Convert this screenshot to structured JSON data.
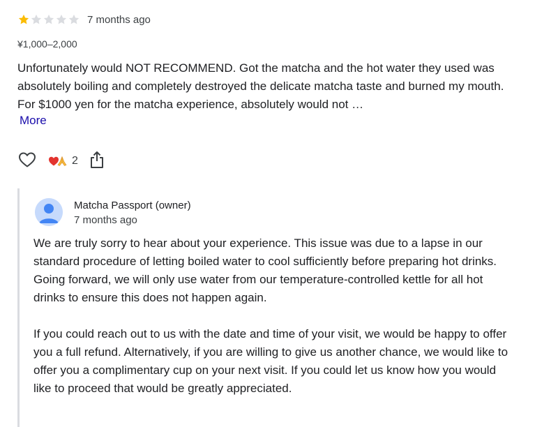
{
  "review": {
    "rating": 1,
    "rating_max": 5,
    "time_ago": "7 months ago",
    "price_range": "¥1,000–2,000",
    "text": "Unfortunately would NOT RECOMMEND. Got the matcha and the hot water they used was absolutely boiling and completely destroyed the delicate matcha taste and burned my mouth. For $1000 yen for the matcha experience, absolutely would not …",
    "more_label": "More",
    "reactions": {
      "icons": [
        "heart-emoji",
        "folded-hands-emoji"
      ],
      "count": "2"
    },
    "actions": {
      "like_icon": "heart-outline-icon",
      "share_icon": "share-icon"
    },
    "colors": {
      "star_filled": "#fbbc04",
      "star_empty": "#dadce0",
      "link": "#1a0dab"
    }
  },
  "owner_reply": {
    "name": "Matcha Passport (owner)",
    "time_ago": "7 months ago",
    "avatar_icon": "default-avatar-icon",
    "paragraphs": [
      "We are truly sorry to hear about your experience. This issue was due to a lapse in our standard procedure of letting boiled water to cool sufficiently before preparing hot drinks. Going forward, we will only use water from our temperature-controlled kettle for all hot drinks to ensure this does not happen again.",
      "If you could reach out to us with the date and time of your visit, we would be happy to offer you a full refund. Alternatively, if you are willing to give us another chance, we would like to offer you a complimentary cup on your next visit. If you could let us know how you would like to proceed that would be greatly appreciated."
    ]
  }
}
